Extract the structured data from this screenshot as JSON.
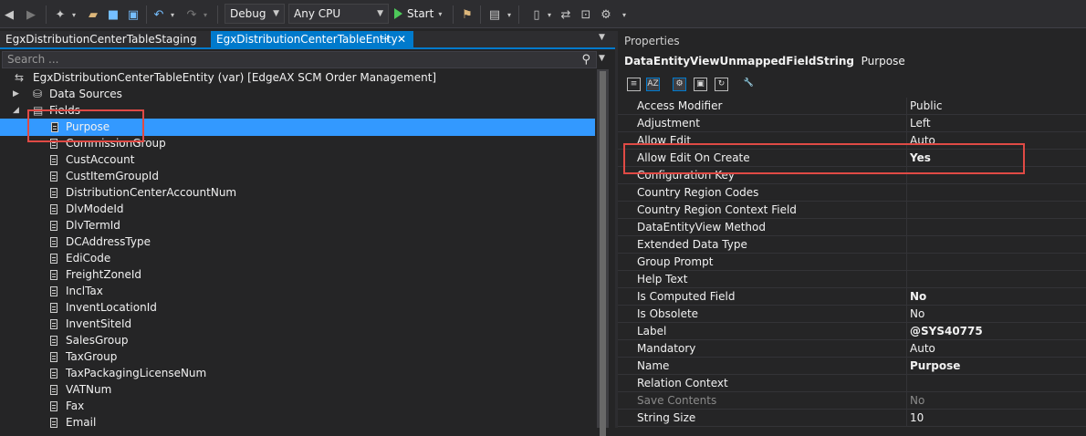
{
  "toolbar": {
    "configuration": "Debug",
    "platform": "Any CPU",
    "start_label": "Start"
  },
  "tabs": [
    {
      "label": "EgxDistributionCenterTableStaging"
    },
    {
      "label": "EgxDistributionCenterTableEntity"
    }
  ],
  "search": {
    "placeholder": "Search ..."
  },
  "tree": {
    "root": "EgxDistributionCenterTableEntity (var) [EdgeAX SCM Order Management]",
    "data_sources": "Data Sources",
    "fields_label": "Fields",
    "fields": [
      "Purpose",
      "CommissionGroup",
      "CustAccount",
      "CustItemGroupId",
      "DistributionCenterAccountNum",
      "DlvModeId",
      "DlvTermId",
      "DCAddressType",
      "EdiCode",
      "FreightZoneId",
      "InclTax",
      "InventLocationId",
      "InventSiteId",
      "SalesGroup",
      "TaxGroup",
      "TaxPackagingLicenseNum",
      "VATNum",
      "Fax",
      "Email"
    ]
  },
  "properties": {
    "title": "Properties",
    "object_type": "DataEntityViewUnmappedFieldString",
    "object_name": "Purpose",
    "rows": [
      {
        "name": "Access Modifier",
        "value": "Public"
      },
      {
        "name": "Adjustment",
        "value": "Left"
      },
      {
        "name": "Allow Edit",
        "value": "Auto"
      },
      {
        "name": "Allow Edit On Create",
        "value": "Yes"
      },
      {
        "name": "Configuration Key",
        "value": ""
      },
      {
        "name": "Country Region Codes",
        "value": ""
      },
      {
        "name": "Country Region Context Field",
        "value": ""
      },
      {
        "name": "DataEntityView Method",
        "value": ""
      },
      {
        "name": "Extended Data Type",
        "value": ""
      },
      {
        "name": "Group Prompt",
        "value": ""
      },
      {
        "name": "Help Text",
        "value": ""
      },
      {
        "name": "Is Computed Field",
        "value": "No"
      },
      {
        "name": "Is Obsolete",
        "value": "No"
      },
      {
        "name": "Label",
        "value": "@SYS40775"
      },
      {
        "name": "Mandatory",
        "value": "Auto"
      },
      {
        "name": "Name",
        "value": "Purpose"
      },
      {
        "name": "Relation Context",
        "value": ""
      },
      {
        "name": "Save Contents",
        "value": "No"
      },
      {
        "name": "String Size",
        "value": "10"
      }
    ]
  },
  "colors": {
    "accent": "#007acc",
    "selection": "#3399ff",
    "highlight_box": "#e04a45"
  }
}
